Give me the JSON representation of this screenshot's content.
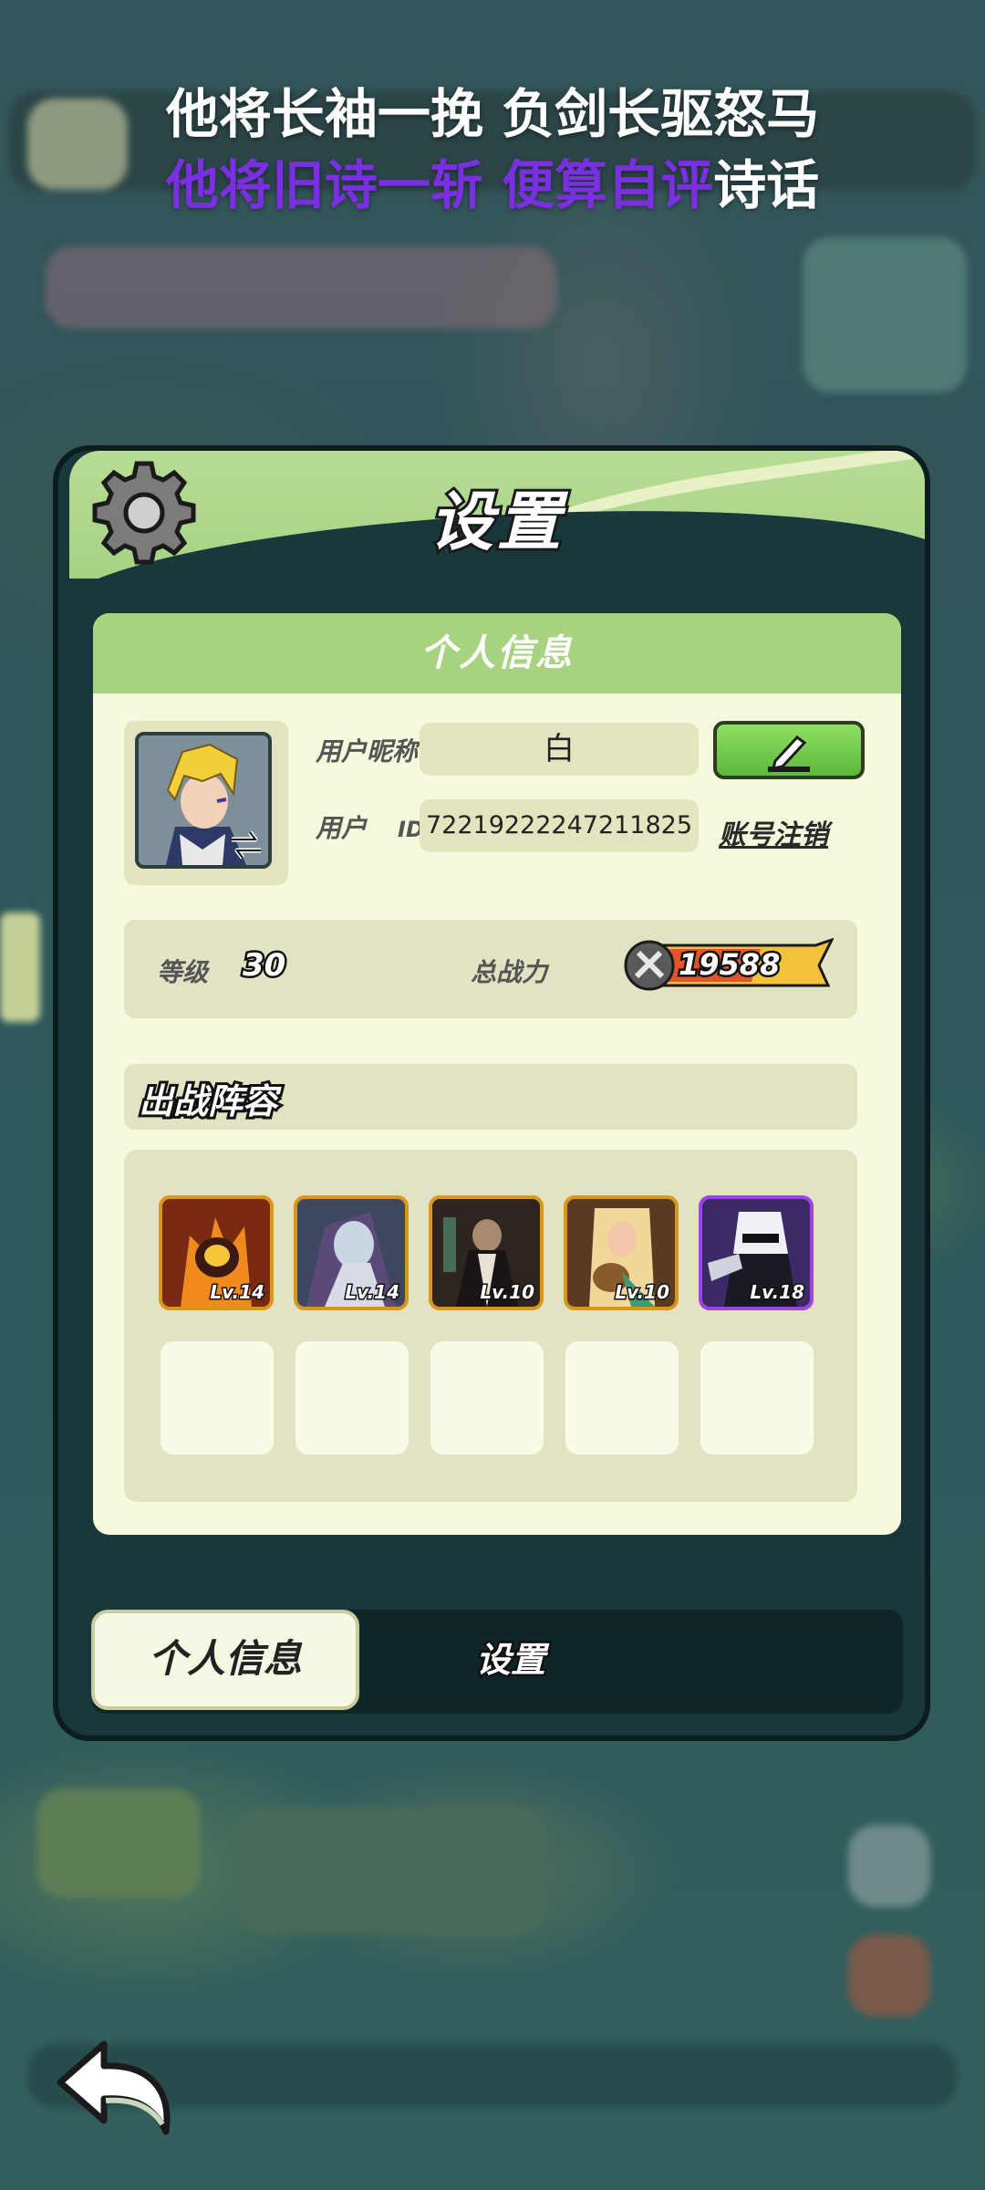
{
  "lyrics": {
    "line1": "他将长袖一挽 负剑长驱怒马",
    "line2_highlight": "他将旧诗一斩 便算自评",
    "line2_rest": "诗话"
  },
  "panel": {
    "title": "设置",
    "card_title": "个人信息",
    "profile": {
      "nickname_label": "用户昵称",
      "nickname_value": "白",
      "id_label_1": "用户",
      "id_label_2": "ID",
      "id_value": "72219222247211825",
      "cancel_account_label": "账号注销"
    },
    "stats": {
      "level_label": "等级",
      "level_value": "30",
      "power_label": "总战力",
      "power_value": "19588"
    },
    "lineup": {
      "title": "出战阵容",
      "heroes": [
        {
          "level": "Lv.14",
          "color": "#c9571e",
          "frame": "#d9951c"
        },
        {
          "level": "Lv.14",
          "color": "#58607a",
          "frame": "#d9951c"
        },
        {
          "level": "Lv.10",
          "color": "#3e2a24",
          "frame": "#d9951c"
        },
        {
          "level": "Lv.10",
          "color": "#6e4a2c",
          "frame": "#d9951c"
        },
        {
          "level": "Lv.18",
          "color": "#3b2a66",
          "frame": "#9b45e6"
        }
      ]
    }
  },
  "tabs": {
    "info": "个人信息",
    "settings": "设置"
  }
}
